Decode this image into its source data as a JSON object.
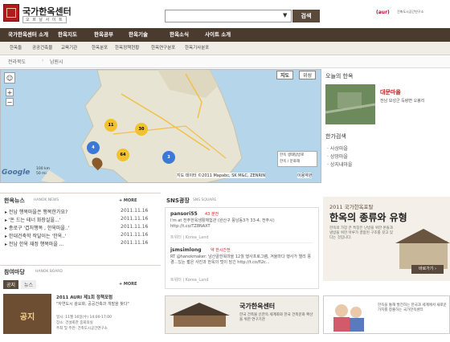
{
  "header": {
    "logo_title": "국가한옥센터",
    "logo_sub": "오 르 날 사 이 트",
    "search_placeholder": "",
    "search_button": "검색",
    "partner_logo": "(aur)",
    "partner_sub": "건축도시공간연구소"
  },
  "nav": {
    "items": [
      "국가한옥센터 소개",
      "한옥지도",
      "한옥공부",
      "한옥기술",
      "한옥소식",
      "사이트 소개"
    ]
  },
  "subnav": {
    "items": [
      "한옥들",
      "공공건축물",
      "교육기관",
      "한옥분포",
      "한옥정책현황",
      "한옥연구분포",
      "한옥기사분포"
    ]
  },
  "breadcrumb": {
    "items": [
      "전라북도",
      "남원시"
    ]
  },
  "map": {
    "tab_map": "지도",
    "tab_sat": "위성",
    "notice": "지도 데이터 ©2011 Mapabc, SK M&C, ZENRIN",
    "notice_right": "이용약관",
    "google": "Google",
    "scale_km": "100 km",
    "scale_mi": "50 mi",
    "legend1": "한옥 생태탐방로",
    "legend2": "한옥 / 문화재",
    "clusters": [
      {
        "label": "11",
        "color": "#f2c12e"
      },
      {
        "label": "30",
        "color": "#f2c12e"
      },
      {
        "label": "4",
        "color": "#3b78d8"
      },
      {
        "label": "64",
        "color": "#f2c12e"
      },
      {
        "label": "3",
        "color": "#3b78d8"
      }
    ],
    "accent": "#4b3b2f"
  },
  "today": {
    "heading": "오늘의 한옥",
    "name": "대문마을",
    "desc": "전남 보성군 득량면 오봉리"
  },
  "search_panel": {
    "heading": "한가검색",
    "items": [
      "사상마을",
      "상망마을",
      "상지내마을"
    ]
  },
  "news": {
    "title": "한옥뉴스",
    "sub": "HANOK NEWS",
    "more": "+ MORE",
    "items": [
      {
        "text": "전남 행복마을은 행복한가요?",
        "date": "2011.11.16"
      },
      {
        "text": "'돈 드는 테너 화장실을...'",
        "date": "2011.11.16"
      },
      {
        "text": "종로구 '겹처행복 , 한옥마을..'",
        "date": "2011.11.16"
      },
      {
        "text": "한대건축학 작달이는 '한옥..'",
        "date": "2011.11.16"
      },
      {
        "text": "전남 한옥 재정 행복마을 ...",
        "date": "2011.11.16"
      }
    ]
  },
  "board": {
    "title": "참여마당",
    "sub": "HANOK BOARD",
    "more": "+ MORE",
    "tabs": [
      "공지",
      "뉴스"
    ],
    "item_title": "2011 AURI 제1회 정책포럼",
    "item_desc": "\"자연도시 광요화, 공공건축과 개발을 찾다\"",
    "item_date": "일시: 11월 16일(수) 14:00-17:00",
    "item_place": "장소: 건설회관 중회의실",
    "item_host": "주최 및 주관: 건축도시공간연구소",
    "image_label": "공지"
  },
  "sns": {
    "title": "SNS광장",
    "sub": "SNS SQUARE",
    "posts": [
      {
        "name": "pansori55",
        "meta": "43 분전",
        "text": "I'm at 전주한옥생활체험관 (완산구 풍남동3가 33-4, 전주시) http://t.co/TZ8NAXT",
        "actions": "트위터 | Korea_Land"
      },
      {
        "name": "jsmsimlong",
        "meta": "약 한시간전",
        "text": "RT @hanokmaker: 남산골한옥마을 12월 행사프로그램, 겨울마다 행사가 열리 풍경...있는 짧은 사진과 한옥의 멋이 담긴 http://t.co/fl2c...",
        "actions": "트위터 | Korea_Land"
      }
    ]
  },
  "banner1": {
    "t1": "2011 국가한옥포탈",
    "t2": "한옥의 종류와 유형",
    "desc": "한옥의 가장 큰 특징은 난방을 위한 온돌과 냉방을 위한 마루가 결합된 구조를 갖고 있다는 것입니다.",
    "button": "바로가기 ›"
  },
  "banner2": {
    "title": "국가한옥센터",
    "sub": "한국 건축물 신한옥 세계화와 한국 건축문화 확산을 위한 연구기관"
  },
  "banner3": {
    "text": "한옥을 통해 발전하는 한국과 세계에서 새로운 가치를 창출하는 국가한옥센터"
  }
}
